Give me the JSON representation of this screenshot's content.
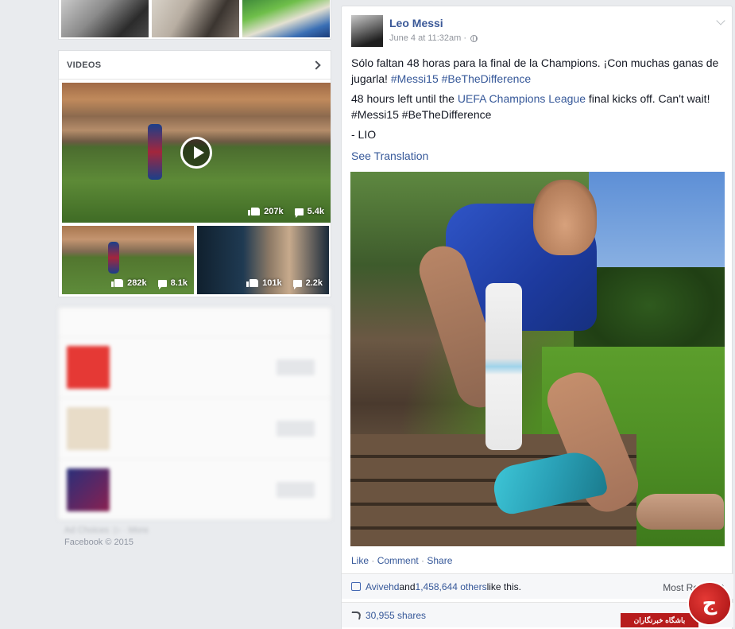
{
  "videos": {
    "title": "VIDEOS",
    "main": {
      "likes": "207k",
      "comments": "5.4k"
    },
    "small": [
      {
        "likes": "282k",
        "comments": "8.1k"
      },
      {
        "likes": "101k",
        "comments": "2.2k"
      }
    ]
  },
  "footer": {
    "ad_choices": "Ad Choices",
    "more": "More",
    "copyright": "Facebook © 2015"
  },
  "post": {
    "author": "Leo Messi",
    "timestamp": "June 4 at 11:32am",
    "meta_sep": "·",
    "para1_text": "Sólo faltan 48 horas para la final de la Champions. ¡Con muchas ganas de jugarla! ",
    "para1_tags": "#Messi15 #BeTheDifference",
    "para2_pre": "48 hours left until the ",
    "para2_link": "UEFA Champions League",
    "para2_post": " final kicks off. Can't wait! ",
    "para2_tags": "#Messi15 #BeTheDifference",
    "signature": "- LIO",
    "see_translation": "See Translation",
    "actions": {
      "like": "Like",
      "comment": "Comment",
      "share": "Share",
      "sep": " · "
    },
    "likes_first": "Avivehd",
    "likes_and": " and ",
    "likes_others": "1,458,644 others",
    "likes_tail": " like this.",
    "most_relevant": "Most Relevant",
    "shares": "30,955 shares"
  },
  "watermark": {
    "text": "باشگاه خبرنگاران",
    "logo_char": "ج"
  },
  "colors": {
    "link": "#365899",
    "background": "#e9ebee",
    "watermark": "#b71c1c"
  }
}
